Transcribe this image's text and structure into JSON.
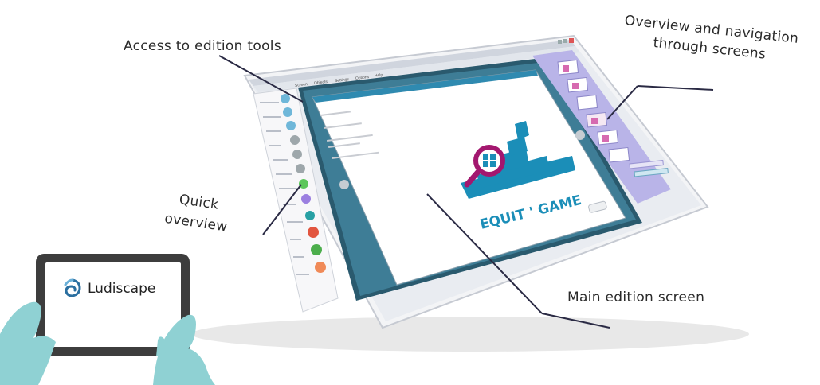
{
  "annotations": {
    "tools": "Access to edition tools",
    "overview_line1": "Overview and navigation",
    "overview_line2": "through screens",
    "quick_line1": "Quick",
    "quick_line2": "overview",
    "main": "Main edition screen"
  },
  "menu": {
    "items": [
      "Screen",
      "Objects",
      "Settings",
      "Options",
      "Help"
    ]
  },
  "game_logo": {
    "text": "EQUIT ' GAME"
  },
  "tablet": {
    "brand": "Ludiscape"
  },
  "colors": {
    "accent_blue": "#1f8fb5",
    "magenta": "#a3176f",
    "window_frame": "#d9dde4",
    "side_panel": "#b9b4e8",
    "screen_border": "#2c8ab0",
    "hand": "#8fd1d3"
  },
  "icons": {
    "tablet_logo": "ludiscape-swirl-icon",
    "magnifier": "magnifier-icon",
    "tools": "tool-circle-icon"
  }
}
